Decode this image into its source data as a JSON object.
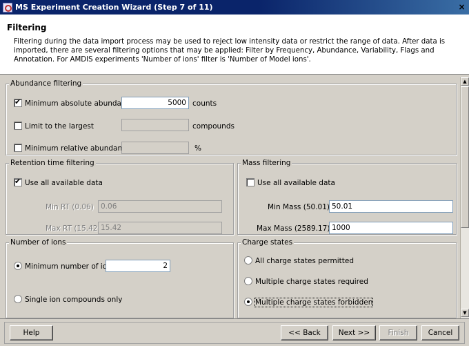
{
  "window": {
    "title": "MS Experiment Creation Wizard (Step 7 of 11)",
    "close_label": "×"
  },
  "header": {
    "title": "Filtering",
    "description": "Filtering during the data import process may be used to reject low intensity data or restrict the range of data. After data is imported, there are several filtering options that may be applied: Filter by Frequency, Abundance, Variability, Flags and Annotation. For AMDIS experiments 'Number of ions' filter is 'Number of Model ions'."
  },
  "abundance": {
    "legend": "Abundance filtering",
    "min_abs": {
      "label": "Minimum absolute abundance",
      "checked": true,
      "value": "5000",
      "unit": "counts"
    },
    "limit_largest": {
      "label": "Limit to the largest",
      "checked": false,
      "value": "",
      "unit": "compounds"
    },
    "min_rel": {
      "label": "Minimum relative abundance",
      "checked": false,
      "value": "",
      "unit": "%"
    }
  },
  "retention": {
    "legend": "Retention time filtering",
    "use_all": {
      "label": "Use all available data",
      "checked": true
    },
    "min_rt": {
      "label": "Min RT (0.06)",
      "value": "0.06"
    },
    "max_rt": {
      "label": "Max RT (15.42)",
      "value": "15.42"
    }
  },
  "mass": {
    "legend": "Mass filtering",
    "use_all": {
      "label": "Use all available data",
      "checked": false
    },
    "min_mass": {
      "label": "Min Mass (50.01)",
      "value": "50.01"
    },
    "max_mass": {
      "label": "Max Mass (2589.17)",
      "value": "1000"
    }
  },
  "ions": {
    "legend": "Number of ions",
    "min_ions": {
      "label": "Minimum number of ions",
      "value": "2"
    },
    "single": {
      "label": "Single ion compounds only"
    }
  },
  "charge": {
    "legend": "Charge states",
    "all": {
      "label": "All charge states permitted"
    },
    "required": {
      "label": "Multiple charge states required"
    },
    "forbidden": {
      "label": "Multiple charge states forbidden"
    }
  },
  "buttons": {
    "help": "Help",
    "back": "<< Back",
    "next": "Next >>",
    "finish": "Finish",
    "cancel": "Cancel"
  },
  "colors": {
    "title_bar": "#0a246a",
    "dialog_bg": "#d4d0c8"
  }
}
